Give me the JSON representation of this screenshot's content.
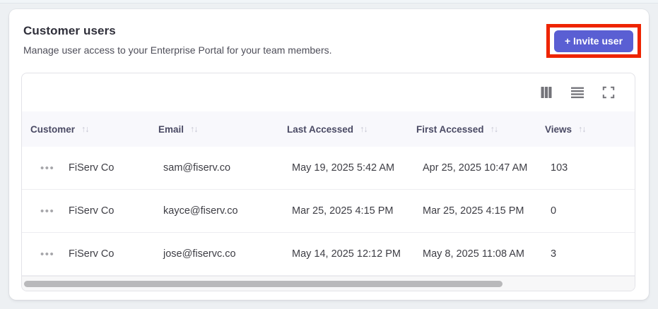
{
  "page": {
    "title": "Customer users",
    "subtitle": "Manage user access to your Enterprise Portal for your team members."
  },
  "actions": {
    "invite_button_label": "+ Invite user"
  },
  "icons": {
    "sort": "↑↓",
    "row_menu": "•••"
  },
  "colors": {
    "accent": "#5a5fd3",
    "annotation_highlight": "#ee2400",
    "header_row_bg": "#f8f8fc"
  },
  "table": {
    "columns": [
      {
        "label": "Customer"
      },
      {
        "label": "Email"
      },
      {
        "label": "Last Accessed"
      },
      {
        "label": "First Accessed"
      },
      {
        "label": "Views"
      }
    ],
    "rows": [
      {
        "customer": "FiServ Co",
        "email": "sam@fiserv.co",
        "last_accessed": "May 19, 2025 5:42 AM",
        "first_accessed": "Apr 25, 2025 10:47 AM",
        "views": "103"
      },
      {
        "customer": "FiServ Co",
        "email": "kayce@fiserv.co",
        "last_accessed": "Mar 25, 2025 4:15 PM",
        "first_accessed": "Mar 25, 2025 4:15 PM",
        "views": "0"
      },
      {
        "customer": "FiServ Co",
        "email": "jose@fiservc.co",
        "last_accessed": "May 14, 2025 12:12 PM",
        "first_accessed": "May 8, 2025 11:08 AM",
        "views": "3"
      }
    ]
  }
}
